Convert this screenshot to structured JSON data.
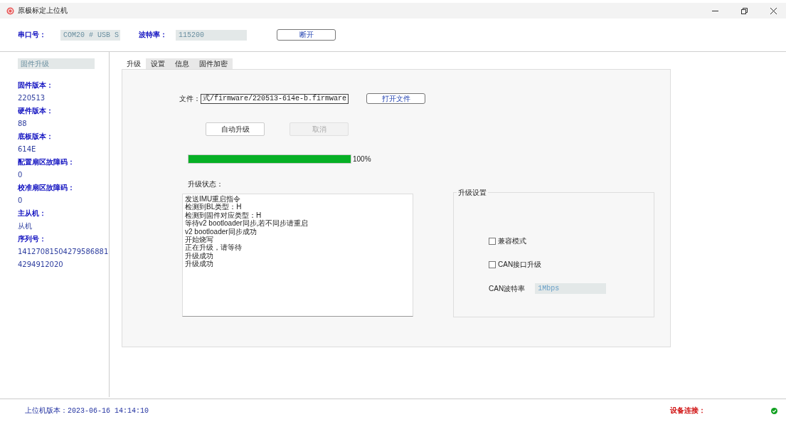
{
  "window": {
    "title": "原极标定上位机"
  },
  "connection": {
    "port_label": "串口号：",
    "port_value": "COM20 # USB S",
    "baud_label": "波特率：",
    "baud_value": "115200",
    "button": "断开"
  },
  "sidebar": {
    "mode": "固件升级",
    "items": [
      {
        "kind": "label",
        "text": "固件版本："
      },
      {
        "kind": "value",
        "text": "220513"
      },
      {
        "kind": "label",
        "text": "硬件版本："
      },
      {
        "kind": "value",
        "text": "88"
      },
      {
        "kind": "label",
        "text": "底板版本："
      },
      {
        "kind": "value",
        "text": "614E"
      },
      {
        "kind": "label",
        "text": "配置扇区故障码："
      },
      {
        "kind": "value",
        "text": "0"
      },
      {
        "kind": "label",
        "text": "校准扇区故障码："
      },
      {
        "kind": "value",
        "text": "0"
      },
      {
        "kind": "label",
        "text": "主从机："
      },
      {
        "kind": "value",
        "text": "从机"
      },
      {
        "kind": "label",
        "text": "序列号："
      },
      {
        "kind": "value",
        "text": "14127081504279586881"
      },
      {
        "kind": "value",
        "text": "4294912020"
      }
    ]
  },
  "tabs": [
    {
      "label": "升级",
      "selected": true
    },
    {
      "label": "设置",
      "selected": false
    },
    {
      "label": "信息",
      "selected": false
    },
    {
      "label": "固件加密",
      "selected": false
    }
  ],
  "upgrade": {
    "file_label": "文件：",
    "file_value": "式/firmware/220513-614e-b.firmware",
    "open_button": "打开文件",
    "buttons": [
      {
        "label": "自动升级",
        "disabled": false
      },
      {
        "label": "取消",
        "disabled": true
      }
    ],
    "progress": {
      "level": 1.0,
      "reading": "100%"
    },
    "status_label": "升级状态：",
    "log": [
      "发送IMU重启指令",
      "检测到BL类型：H",
      "检测到固件对应类型：H",
      "等待v2 bootloader同步,若不同步请重启",
      "v2 bootloader同步成功",
      "开始烧写",
      "正在升级，请等待",
      "升级成功",
      "升级成功"
    ],
    "settings": {
      "title": "升级设置",
      "options": [
        {
          "label": "兼容模式",
          "checked": false
        },
        {
          "label": "CAN接口升级",
          "checked": false
        }
      ],
      "can_baud_label": "CAN波特率",
      "can_baud_value": "1Mbps"
    }
  },
  "status_bar": {
    "version": "上位机版本：2023-06-16 14:14:10",
    "device_status": "设备连接：",
    "connected": true
  }
}
